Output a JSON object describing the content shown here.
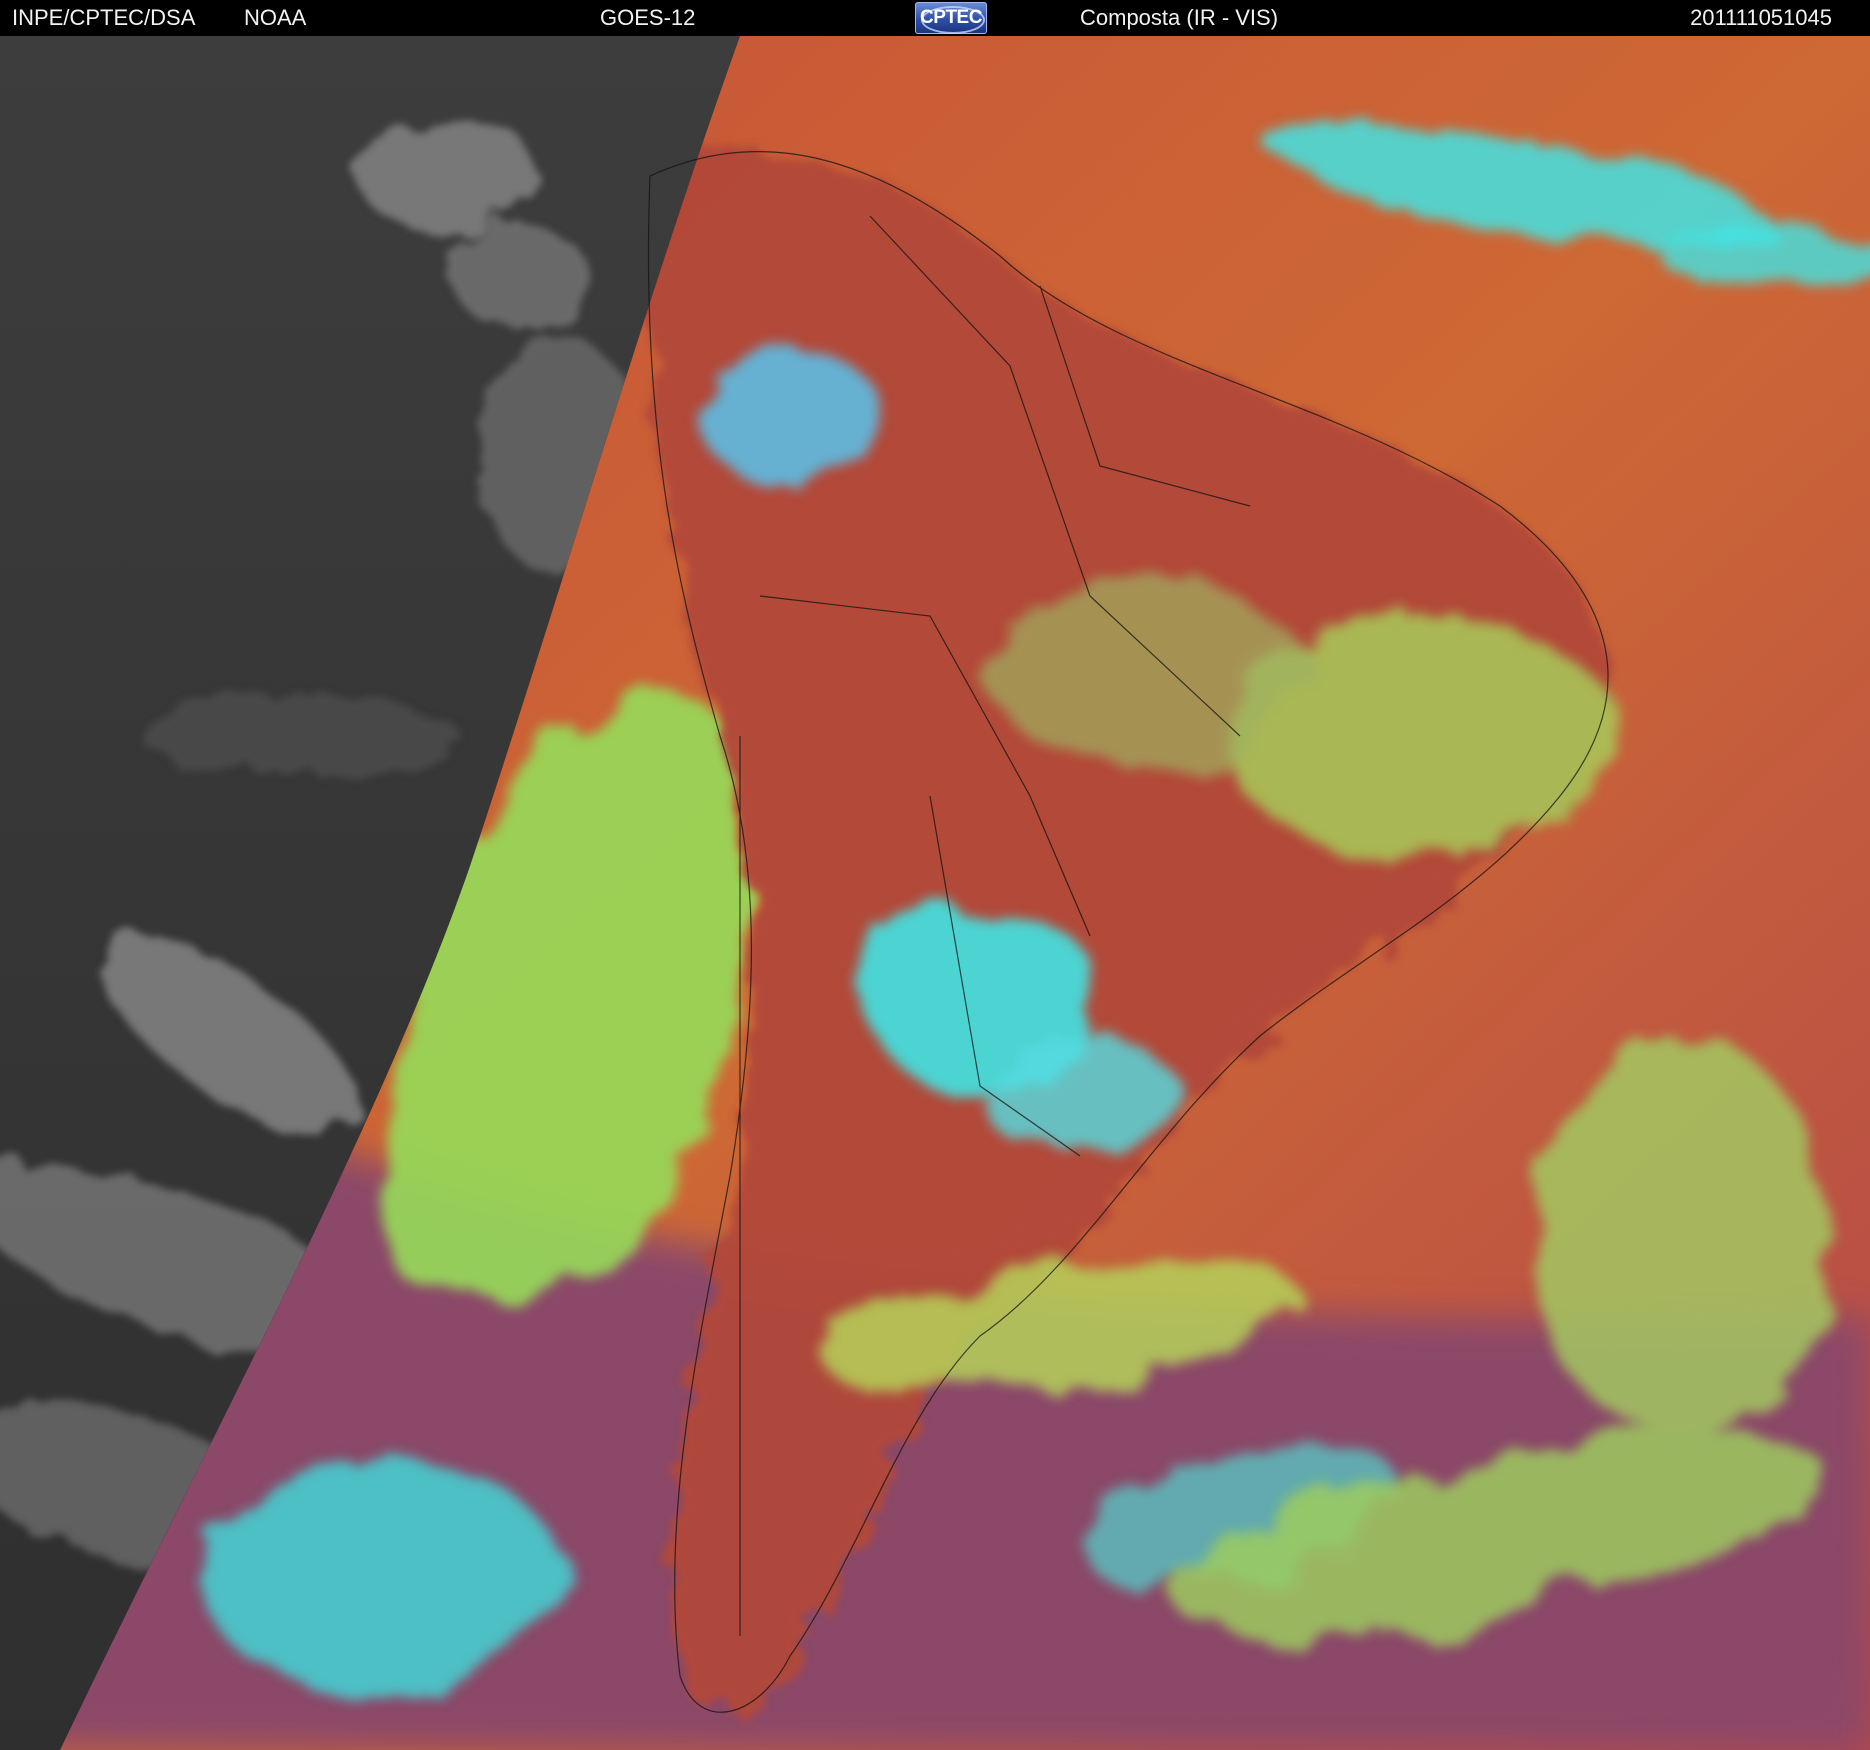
{
  "header": {
    "organization": "INPE/CPTEC/DSA",
    "agency": "NOAA",
    "satellite": "GOES-12",
    "logo_text": "CPTEC",
    "product": "Composta (IR - VIS)",
    "timestamp": "201111051045"
  },
  "colors": {
    "header_bg": "#000000",
    "header_text": "#f2f2f2",
    "night_side": "#3a3a3a",
    "land_composite": "#b24a3a",
    "low_cloud": "#96e05a",
    "high_cloud": "#3fe8e8",
    "ocean_south": "#8a4a6a",
    "ocean_east": "#d8702f"
  }
}
